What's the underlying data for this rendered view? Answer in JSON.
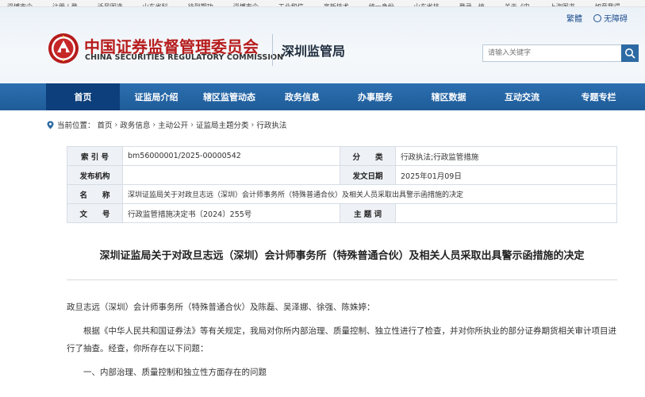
{
  "bookmarks": [
    {
      "label": "淄博市企…",
      "color": "red"
    },
    {
      "label": "注册 | 登…",
      "color": "blue"
    },
    {
      "label": "沃风图选…",
      "color": "orange"
    },
    {
      "label": "山东省科…",
      "color": "green"
    },
    {
      "label": "待到期功…",
      "color": "red"
    },
    {
      "label": "淄博市企…",
      "color": "red"
    },
    {
      "label": "工业和信…",
      "color": "blue"
    },
    {
      "label": "高新技术…",
      "color": "red"
    },
    {
      "label": "统一身份…",
      "color": "orange"
    },
    {
      "label": "山东省技…",
      "color": "purple"
    },
    {
      "label": "登录 - 统…",
      "color": "blue"
    },
    {
      "label": "关于《中…",
      "color": "red"
    },
    {
      "label": "上海图书…",
      "color": "blue"
    },
    {
      "label": "如意我得…",
      "color": "red"
    }
  ],
  "header": {
    "links": {
      "traditional": "繁體",
      "accessibility": "无障碍"
    },
    "logo_cn": "中国证券监督管理委员会",
    "logo_en": "CHINA SECURITIES REGULATORY COMMISSION",
    "bureau": "深圳监管局",
    "search_placeholder": "请输入关键字"
  },
  "nav": {
    "items": [
      "首页",
      "证监局介绍",
      "辖区监管动态",
      "政务信息",
      "办事服务",
      "辖区数据",
      "互动交流",
      "专题专栏"
    ],
    "active_index": 0
  },
  "breadcrumb": {
    "prefix": "当前位置：",
    "items": [
      "首页",
      "政务信息",
      "主动公开",
      "证监局主题分类",
      "行政执法"
    ],
    "separator": "›"
  },
  "info": {
    "index_label": "索 引 号",
    "index_value": "bm56000001/2025-00000542",
    "category_label": "分　　类",
    "category_value": "行政执法;行政监管措施",
    "issuer_label": "发布机构",
    "issuer_value": "",
    "date_label": "发文日期",
    "date_value": "2025年01月09日",
    "name_label": "名　　称",
    "name_value": "深圳证监局关于对政旦志远（深圳）会计师事务所（特殊普通合伙）及相关人员采取出具警示函措施的决定",
    "docno_label": "文　　号",
    "docno_value": "行政监管措施决定书〔2024〕255号",
    "subject_label": "主 题 词",
    "subject_value": ""
  },
  "document": {
    "title": "深圳证监局关于对政旦志远（深圳）会计师事务所（特殊普通合伙）及相关人员采取出具警示函措施的决定",
    "salutation": "政旦志远（深圳）会计师事务所（特殊普通合伙）及陈磊、吴泽娜、徐强、陈姝婷：",
    "paragraph1": "根据《中华人民共和国证券法》等有关规定，我局对你所内部治理、质量控制、独立性进行了检查，并对你所执业的部分证券期货相关审计项目进行了抽查。经查，你所存在以下问题：",
    "section1": "一、内部治理、质量控制和独立性方面存在的问题"
  },
  "colors": {
    "nav_bg": "#1f5c99",
    "nav_active": "#0d3f7c",
    "logo_red": "#b71c1c",
    "link_blue": "#1f4f8f"
  }
}
